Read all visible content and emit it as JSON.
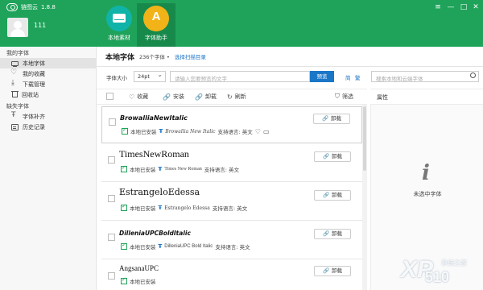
{
  "app": {
    "name": "链图云",
    "version": "1.8.8"
  },
  "user": {
    "name": "111"
  },
  "tools": [
    {
      "label": "本地素材",
      "icon": "disk-icon"
    },
    {
      "label": "字体助手",
      "icon": "font-a-icon",
      "glyph": "A"
    }
  ],
  "window_controls": [
    "≡",
    "—",
    "□",
    "✕"
  ],
  "sidebar": {
    "section1": "我的字体",
    "items1": [
      {
        "label": "本地字体",
        "icon": "monitor-icon",
        "active": true
      },
      {
        "label": "我的收藏",
        "icon": "heart-icon"
      },
      {
        "label": "下载管理",
        "icon": "download-icon"
      },
      {
        "label": "回收站",
        "icon": "trash-icon"
      }
    ],
    "section2": "缺失字体",
    "items2": [
      {
        "label": "字体补齐",
        "icon": "font-icon"
      },
      {
        "label": "历史记录",
        "icon": "history-icon"
      }
    ]
  },
  "main": {
    "title": "本地字体",
    "count_text": "236个字体 •",
    "scan_link": "选择扫描目录",
    "size_label": "字体大小",
    "size_value": "24pt",
    "preview_placeholder": "请输入您要预览的文字",
    "preview_button": "预览",
    "link_simplified": "简",
    "link_traditional": "繁",
    "search_placeholder": "搜索本地和云端字体",
    "toolbar": {
      "favorite": "收藏",
      "install": "安装",
      "uninstall": "卸载",
      "refresh": "刷新",
      "filter": "筛选"
    },
    "properties_title": "属性",
    "no_selection": "未选中字体",
    "installed_label": "本地已安装",
    "lang_label": "支持语言: 英文",
    "row_button": "卸载",
    "link_glyph": "🔗"
  },
  "fonts": [
    {
      "display": "BrowalliaNewItalic",
      "file": "Browallia New Italic"
    },
    {
      "display": "TimesNewRoman",
      "file": "Times New Roman"
    },
    {
      "display": "EstrangeloEdessa",
      "file": "Estrangelo Edessa"
    },
    {
      "display": "DilleniaUPCBoldItalic",
      "file": "DilleniaUPC Bold Italic"
    },
    {
      "display": "AngsanaUPC",
      "file": ""
    }
  ],
  "watermark": {
    "big": "XP",
    "num": "510",
    "text": "系统之家"
  }
}
